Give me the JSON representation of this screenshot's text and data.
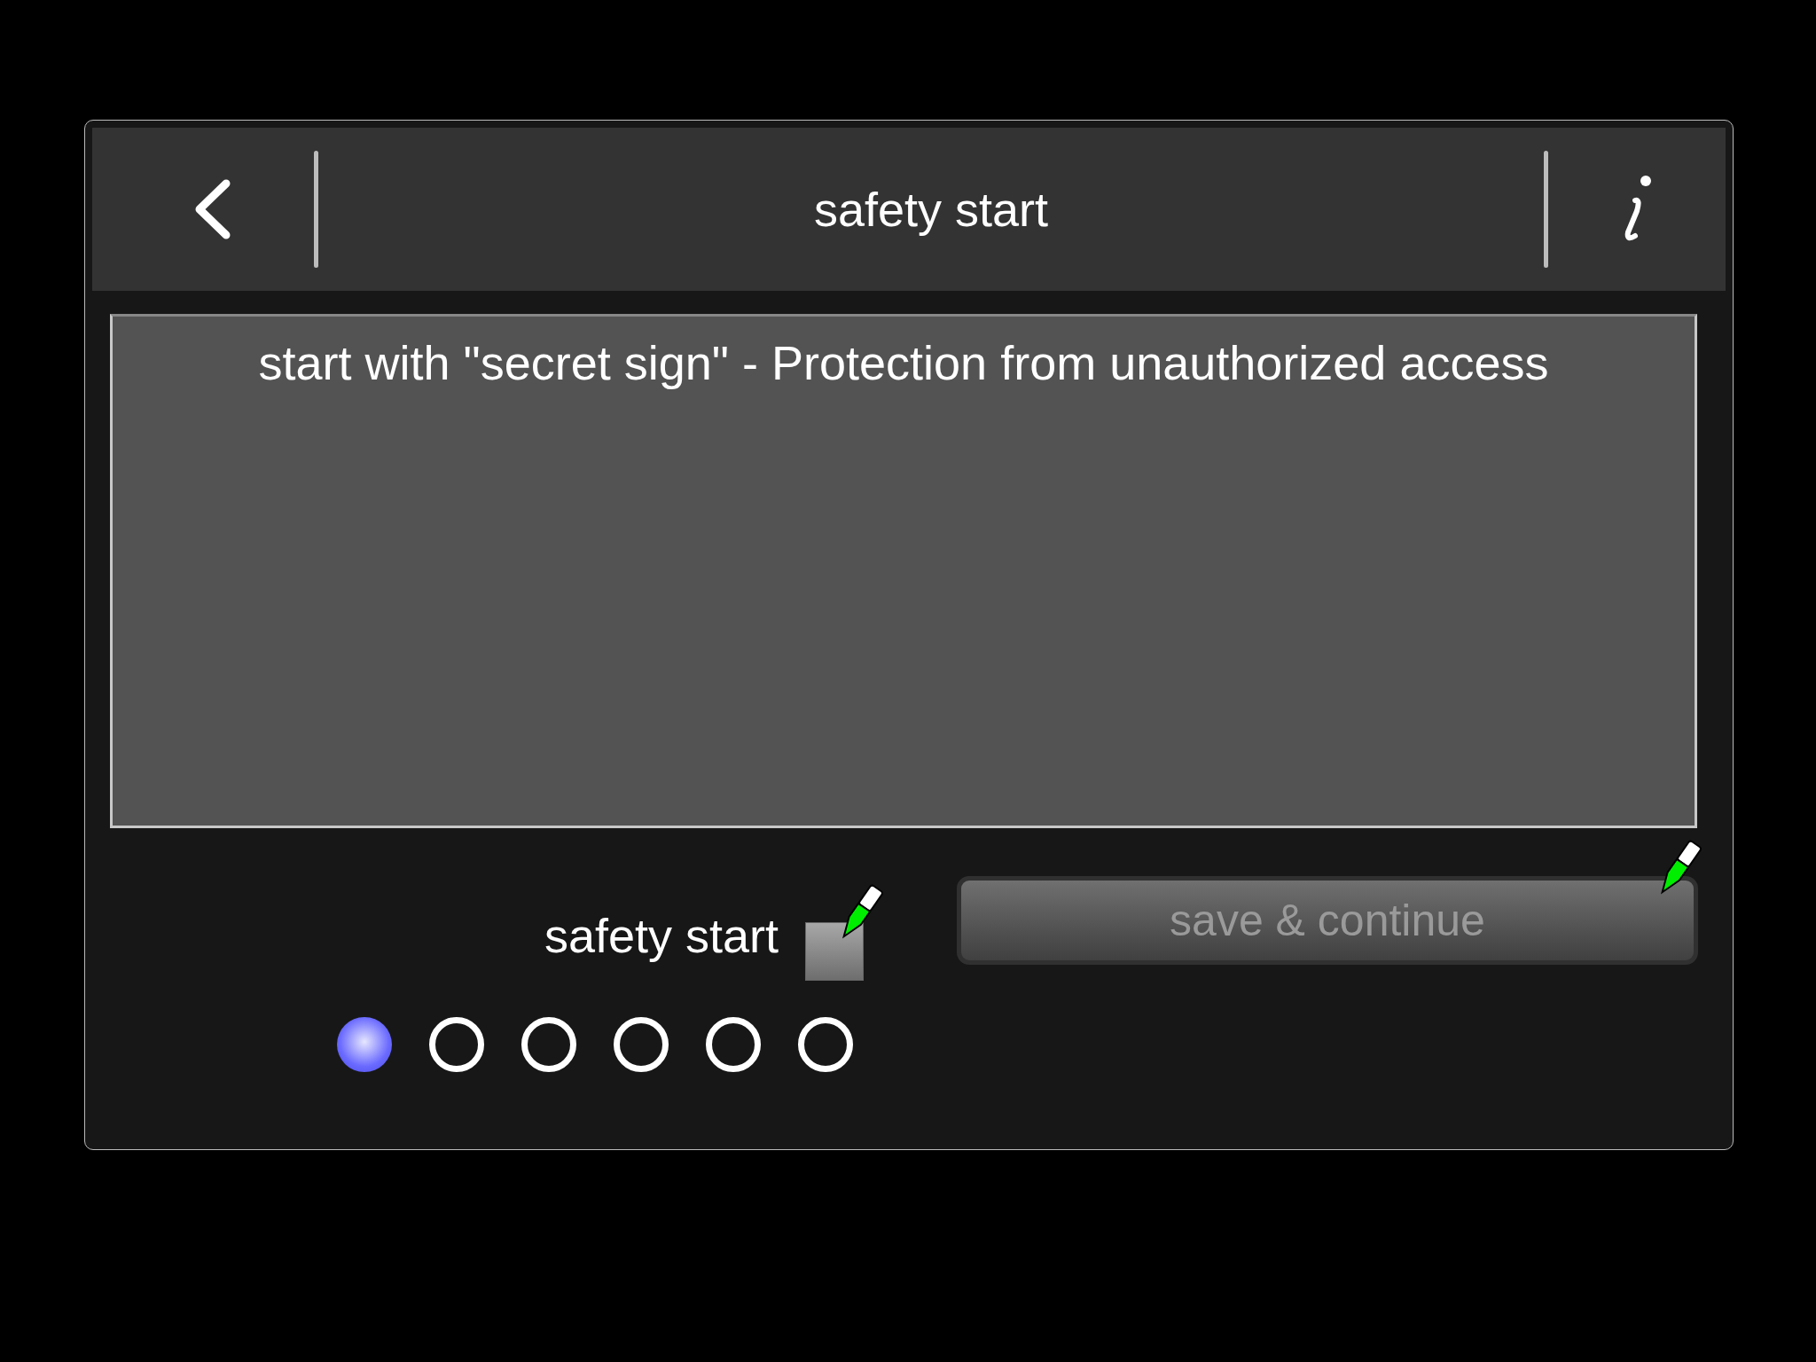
{
  "header": {
    "title": "safety start"
  },
  "message": "start with \"secret sign\" - Protection from unauthorized access",
  "option": {
    "label": "safety start",
    "checked": false
  },
  "save_button": {
    "label": "save & continue",
    "disabled": true
  },
  "pages": [
    {
      "selected": true
    },
    {
      "selected": false
    },
    {
      "selected": false
    },
    {
      "selected": false
    },
    {
      "selected": false
    },
    {
      "selected": false
    }
  ]
}
